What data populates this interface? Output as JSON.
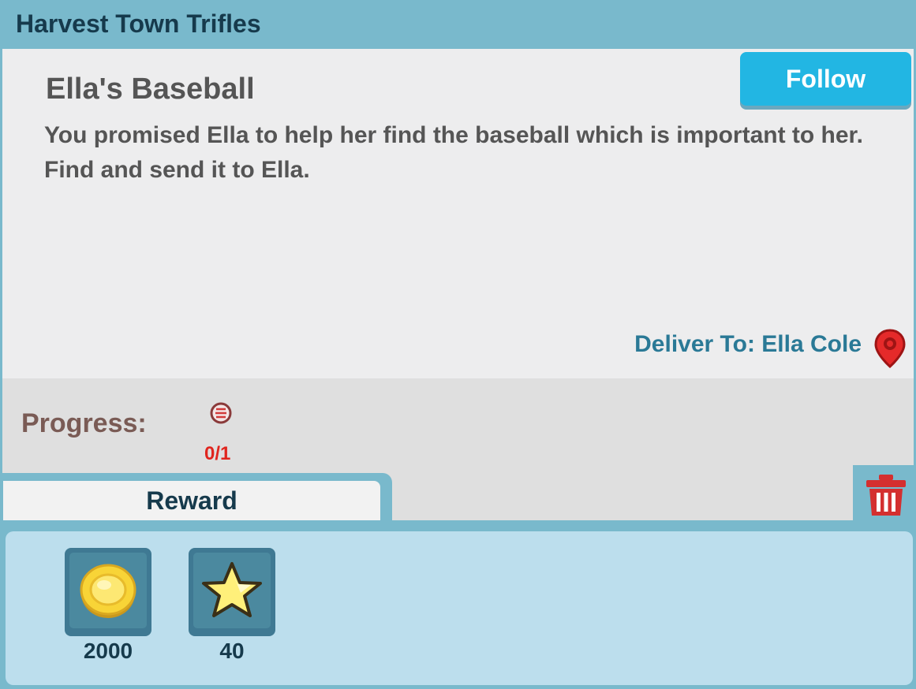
{
  "header": {
    "title": "Harvest Town Trifles"
  },
  "quest": {
    "title": "Ella's Baseball",
    "description": "You promised Ella to help her find the baseball which is important to her. Find and send it to Ella.",
    "follow_label": "Follow",
    "deliver_to": "Deliver To: Ella Cole"
  },
  "progress": {
    "label": "Progress:",
    "item_icon": "baseball-icon",
    "count": "0/1"
  },
  "tabs": {
    "reward_label": "Reward"
  },
  "rewards": [
    {
      "icon": "gold-coin-icon",
      "value": "2000"
    },
    {
      "icon": "star-icon",
      "value": "40"
    }
  ],
  "colors": {
    "header_bg": "#79b9cc",
    "follow_button": "#22b6e3",
    "progress_count": "#e0251e",
    "deliver_text": "#2a7996"
  }
}
